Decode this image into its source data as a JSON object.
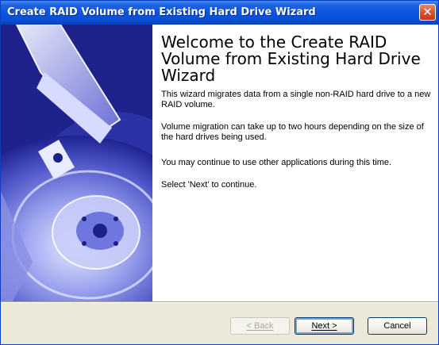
{
  "window": {
    "title": "Create RAID Volume from Existing Hard Drive Wizard",
    "close_icon": "close-icon"
  },
  "main": {
    "heading": "Welcome to the Create RAID Volume from Existing Hard Drive Wizard",
    "paragraphs": [
      "This wizard migrates data from a single non-RAID hard drive to a new RAID volume.",
      "Volume migration can take up to two hours depending on the size of the hard drives being used.",
      "You may continue to use other applications during this time.",
      "Select 'Next' to continue."
    ]
  },
  "buttons": {
    "back": "< Back",
    "next": "Next >",
    "cancel": "Cancel"
  },
  "colors": {
    "titlebar": "#0a55e0",
    "banner": "#3a40b8",
    "face": "#ece9d8"
  }
}
